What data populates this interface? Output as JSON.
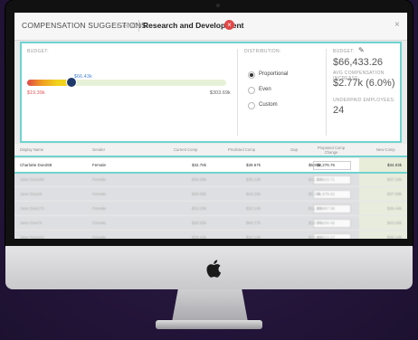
{
  "header": {
    "title": "COMPENSATION SUGGESTIONS:",
    "group_by": "Gender",
    "department": "Research and Development",
    "remove_icon": "x-circle-icon",
    "close_icon": "close-icon"
  },
  "budget": {
    "label": "BUDGET:",
    "min_label": "$19.39k",
    "marker_label": "$66.43k",
    "max_label": "$303.69k",
    "marker_fraction": 0.22,
    "fill_fraction": 0.22
  },
  "distribution": {
    "label": "DISTRIBUTION:",
    "options": [
      "Proportional",
      "Even",
      "Custom"
    ],
    "selected": "Proportional"
  },
  "summary": {
    "budget_label": "BUDGET:",
    "edit_icon": "pencil-icon",
    "budget_value": "$66,433.26",
    "avg_label": "AVG COMPENSATION INCREASE:",
    "avg_value": "$2.77k (6.0%)",
    "underpaid_label": "UNDERPAID EMPLOYEES:",
    "underpaid_value": "24"
  },
  "table": {
    "headers": [
      "Display Name",
      "Gender",
      "Current Comp",
      "Predicted Comp",
      "Gap",
      "Proposed Comp Change",
      "New Comp"
    ],
    "rows": [
      [
        "Charlotte Doe268",
        "Female",
        "$32.76k",
        "$39.67k",
        "$6.91k",
        "$2,276.76",
        "$34.03k"
      ],
      [
        "Jane Doe160",
        "Female",
        "$30.08k",
        "$35.13k",
        "$11.12k",
        "$3,823.71",
        "$37.19k"
      ],
      [
        "Jane Doe28",
        "Female",
        "$38.05k",
        "$43.16k",
        "$5.10k",
        "$1,679.42",
        "$37.88k"
      ],
      [
        "Jane Doe173",
        "Female",
        "$32.03k",
        "$32.14k",
        "$11.16k",
        "$3,997.58",
        "$36.44k"
      ],
      [
        "Jane Doe74",
        "Female",
        "$38.55k",
        "$60.77k",
        "$18.77k",
        "$5,150.45",
        "$43.30k"
      ],
      [
        "Jane Doe102",
        "Female",
        "$29.44k",
        "$42.14k",
        "$13.04k",
        "$7,013.27",
        "$36.14k"
      ]
    ]
  },
  "device": {
    "logo_icon": "apple-logo-icon"
  }
}
